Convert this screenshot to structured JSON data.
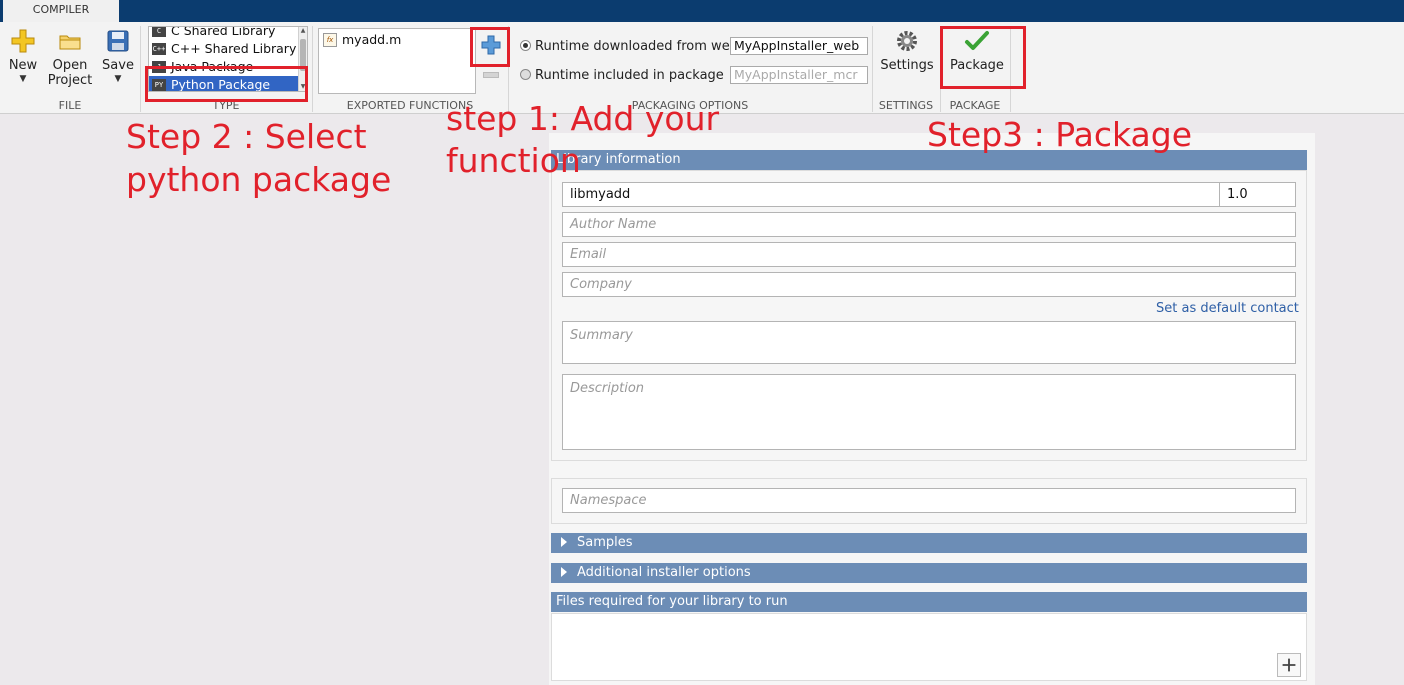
{
  "tab": {
    "label": "COMPILER"
  },
  "file_section": {
    "label": "FILE",
    "new_label": "New",
    "open_label_1": "Open",
    "open_label_2": "Project",
    "save_label": "Save"
  },
  "type_section": {
    "label": "TYPE",
    "items": [
      {
        "label": "C Shared Library",
        "icon_text": "C"
      },
      {
        "label": "C++ Shared Library",
        "icon_text": "C++"
      },
      {
        "label": "Java Package",
        "icon_text": "J"
      },
      {
        "label": "Python Package",
        "icon_text": "PY"
      }
    ],
    "selected": "Python Package"
  },
  "exported_functions": {
    "label": "EXPORTED FUNCTIONS",
    "files": [
      "myadd.m"
    ]
  },
  "packaging_options": {
    "label": "PACKAGING OPTIONS",
    "option_web_label": "Runtime downloaded from web",
    "option_web_value": "MyAppInstaller_web",
    "option_included_label": "Runtime included in package",
    "option_included_value": "MyAppInstaller_mcr",
    "selected": "web"
  },
  "settings_section": {
    "label": "SETTINGS",
    "button": "Settings"
  },
  "package_section": {
    "label": "PACKAGE",
    "button": "Package"
  },
  "annotations": {
    "step1_line1": "step 1: Add your",
    "step1_line2": "function",
    "step2_line1": "Step 2 : Select",
    "step2_line2": "python package",
    "step3": "Step3 : Package",
    "color": "#e1212b"
  },
  "library_info": {
    "header": "Library information",
    "name": "libmyadd",
    "version": "1.0",
    "author_placeholder": "Author Name",
    "email_placeholder": "Email",
    "company_placeholder": "Company",
    "default_contact_link": "Set as default contact",
    "summary_placeholder": "Summary",
    "description_placeholder": "Description"
  },
  "namespace": {
    "placeholder": "Namespace"
  },
  "samples": {
    "header": "Samples"
  },
  "installer_options": {
    "header": "Additional installer options"
  },
  "files_required": {
    "header": "Files required for your library to run"
  },
  "colors": {
    "title_bar": "#0b3c6f",
    "section_header": "#6c8db6",
    "selection": "#3165c4",
    "link": "#2e5fa6"
  }
}
